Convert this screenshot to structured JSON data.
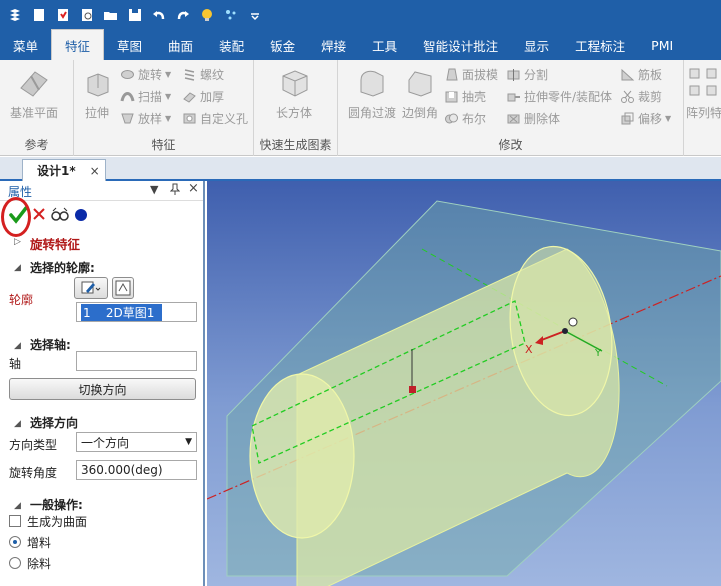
{
  "quick_access": {
    "icons": [
      "app-logo-icon",
      "new-file-icon",
      "save-as-icon",
      "print-preview-icon",
      "open-folder-icon",
      "save-icon",
      "undo-icon",
      "redo-icon",
      "bulb-icon",
      "sparkle-icon",
      "dropdown-icon"
    ]
  },
  "tabs": [
    "菜单",
    "特征",
    "草图",
    "曲面",
    "装配",
    "钣金",
    "焊接",
    "工具",
    "智能设计批注",
    "显示",
    "工程标注",
    "PMI"
  ],
  "active_tab": "特征",
  "ribbon": {
    "reference_group": {
      "label": "参考",
      "datum_plane": "基准平面"
    },
    "feature_group": {
      "label": "特征",
      "extrude": "拉伸",
      "revolve": "旋转",
      "sweep": "扫描",
      "loft": "放样",
      "thread": "螺纹",
      "thicken": "加厚",
      "custom_hole": "自定义孔"
    },
    "quick_group": {
      "label": "快速生成图素",
      "cuboid": "长方体"
    },
    "modify_group": {
      "label": "修改",
      "fillet": "圆角过渡",
      "chamfer": "边倒角",
      "draft": "面拔模",
      "shell": "抽壳",
      "boolean": "布尔",
      "split": "分割",
      "extrude_to_part": "拉伸零件/装配体",
      "delete_body": "删除体",
      "rib": "筋板",
      "trim": "裁剪",
      "offset": "偏移"
    },
    "pattern_group": {
      "array_feature": "阵列特"
    }
  },
  "document_tab": {
    "label": "设计1*",
    "close": "×"
  },
  "panel": {
    "title": "属性",
    "controls": {
      "dropdown": "▼",
      "pin": "ᵖ",
      "close": "×"
    },
    "feature_title": "旋转特征",
    "sections": {
      "profile": "选择的轮廓:",
      "axis": "选择轴:",
      "direction": "选择方向",
      "general": "一般操作:"
    },
    "profile_label": "轮廓",
    "profile_value": "1    2D草图1",
    "axis_label": "轴",
    "axis_value": "",
    "switch_direction": "切换方向",
    "direction_type_label": "方向类型",
    "direction_type_value": "一个方向",
    "angle_label": "旋转角度",
    "angle_value": "360.000(deg)",
    "generate_surface": "生成为曲面",
    "add_material": "增料",
    "remove_material": "除料"
  },
  "colors": {
    "ribbon_blue": "#1f5fa8",
    "accent_red": "#d42020",
    "ok_green": "#1a9a1a",
    "cylinder_fill": "#d9e7a6",
    "sketch_green": "#22cc22",
    "axis_red": "#cc2222"
  }
}
